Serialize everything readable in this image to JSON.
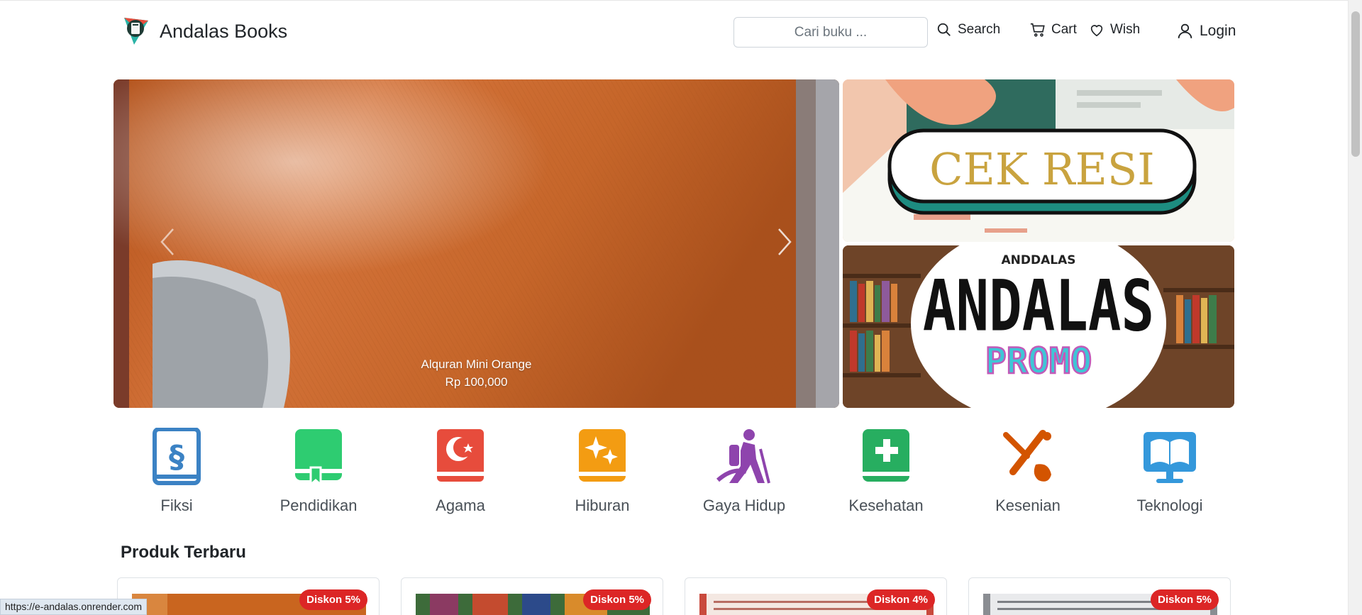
{
  "brand": {
    "name": "Andalas Books",
    "logo_icon": "book-triangle-logo"
  },
  "search": {
    "placeholder": "Cari buku ...",
    "button_label": "Search"
  },
  "nav": {
    "cart_label": "Cart",
    "wish_label": "Wish",
    "login_label": "Login"
  },
  "hero": {
    "caption_title": "Alquran Mini Orange",
    "caption_price": "Rp 100,000",
    "banners": [
      {
        "text": "CEK RESI"
      },
      {
        "top_text": "ANDDALAS",
        "title": "ANDALAS",
        "subtitle": "PROMO"
      }
    ]
  },
  "categories": [
    {
      "label": "Fiksi",
      "icon": "book-section-icon",
      "color": "#3b82c4"
    },
    {
      "label": "Pendidikan",
      "icon": "book-bookmark-icon",
      "color": "#2ecc71"
    },
    {
      "label": "Agama",
      "icon": "book-crescent-icon",
      "color": "#e74c3c"
    },
    {
      "label": "Hiburan",
      "icon": "book-sparkle-icon",
      "color": "#f39c12"
    },
    {
      "label": "Gaya Hidup",
      "icon": "person-hiking-icon",
      "color": "#8e44ad"
    },
    {
      "label": "Kesehatan",
      "icon": "book-medical-icon",
      "color": "#27ae60"
    },
    {
      "label": "Kesenian",
      "icon": "pen-brush-icon",
      "color": "#d35400"
    },
    {
      "label": "Teknologi",
      "icon": "book-tablet-icon",
      "color": "#3498db"
    }
  ],
  "section": {
    "title": "Produk Terbaru"
  },
  "products": [
    {
      "discount": "Diskon 5%"
    },
    {
      "discount": "Diskon 5%"
    },
    {
      "discount": "Diskon 4%"
    },
    {
      "discount": "Diskon 5%"
    }
  ],
  "statusbar": {
    "url": "https://e-andalas.onrender.com"
  },
  "colors": {
    "badge": "#dc2626",
    "text": "#212529",
    "muted": "#495057"
  }
}
